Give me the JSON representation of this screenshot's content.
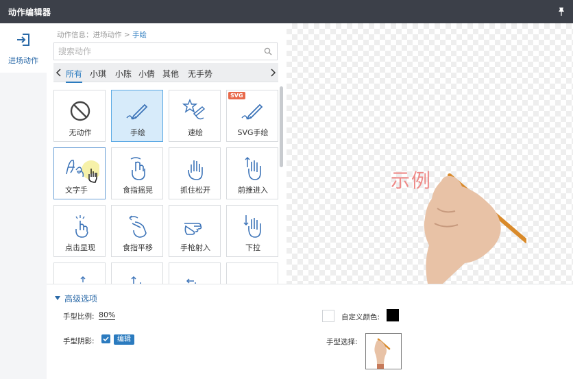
{
  "window": {
    "title": "动作编辑器"
  },
  "nav": {
    "items": [
      {
        "label": "进场动作",
        "icon": "enter-icon"
      }
    ]
  },
  "breadcrumb": {
    "root": "动作信息：进场动作 > ",
    "current": "手绘"
  },
  "search": {
    "placeholder": "搜索动作",
    "value": ""
  },
  "tabs": [
    "所有",
    "小琪",
    "小陈",
    "小倩",
    "其他",
    "无手势"
  ],
  "active_tab": "所有",
  "actions": [
    {
      "label": "无动作",
      "icon": "no-action-icon"
    },
    {
      "label": "手绘",
      "icon": "pen-draw-icon",
      "selected": true
    },
    {
      "label": "速绘",
      "icon": "quick-draw-icon"
    },
    {
      "label": "SVG手绘",
      "icon": "svg-pen-icon",
      "badge": "SVG"
    },
    {
      "label": "文字手",
      "icon": "text-hand-icon"
    },
    {
      "label": "食指摇晃",
      "icon": "finger-shake-icon"
    },
    {
      "label": "抓住松开",
      "icon": "grab-release-icon"
    },
    {
      "label": "前推进入",
      "icon": "push-in-icon"
    },
    {
      "label": "点击显现",
      "icon": "tap-reveal-icon"
    },
    {
      "label": "食指平移",
      "icon": "finger-pan-icon"
    },
    {
      "label": "手枪射入",
      "icon": "finger-gun-icon"
    },
    {
      "label": "下拉",
      "icon": "pull-down-icon"
    }
  ],
  "preview": {
    "sample_text": "示例"
  },
  "advanced": {
    "header": "高级选项",
    "hand_ratio_label": "手型比例:",
    "hand_ratio_value": "80%",
    "hand_shadow_label": "手型阴影:",
    "hand_shadow_checked": true,
    "edit_label": "编辑",
    "custom_color_label": "自定义颜色:",
    "custom_color_checked": false,
    "custom_color": "#000000",
    "hand_select_label": "手型选择:"
  },
  "colors": {
    "accent": "#2b7bbf",
    "titlebar": "#3c4049",
    "selected_card": "#d7ebfa",
    "svg_badge": "#e86a4b"
  }
}
